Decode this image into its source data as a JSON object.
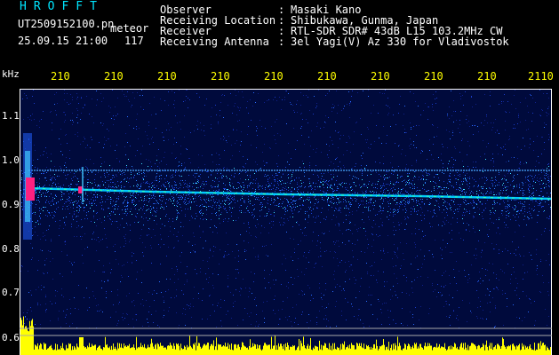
{
  "header": {
    "app_title": "HROFFT",
    "file_name": "UT2509152100.pn",
    "mode": "meteor",
    "date_time": "25.09.15 21:00",
    "count": "117",
    "info": [
      {
        "key": "Observer",
        "value": "Masaki Kano"
      },
      {
        "key": "Receiving Location",
        "value": "Shibukawa, Gunma, Japan"
      },
      {
        "key": "Receiver",
        "value": "RTL-SDR SDR# 43dB L15 103.2MHz CW"
      },
      {
        "key": "Receiving Antenna",
        "value": "3el Yagi(V) Az 330 for Vladivostok"
      }
    ]
  },
  "axes": {
    "y_unit": "kHz",
    "y_ticks": [
      "1.1",
      "1.0",
      "0.9",
      "0.8",
      "0.7",
      "0.6"
    ],
    "time_ticks": [
      "210",
      "210",
      "210",
      "210",
      "210",
      "210",
      "210",
      "210",
      "210",
      "2110"
    ]
  },
  "colors": {
    "background": "#000000",
    "plot_background": "#000a3c",
    "text": "#ffffff",
    "time_labels": "#ffff00",
    "carrier": "#00c8ff",
    "meteor_head": "#ff2080",
    "amplitude": "#ffff00"
  }
}
